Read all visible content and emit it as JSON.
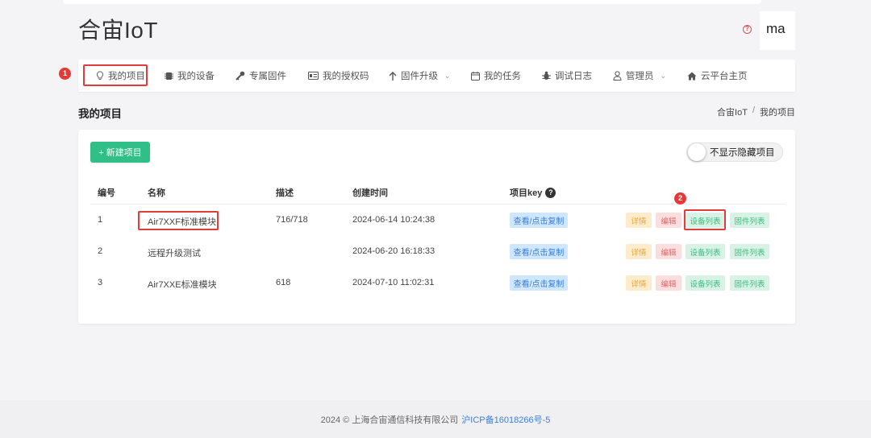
{
  "app": {
    "brand": "合宙IoT",
    "user": "ma"
  },
  "nav": [
    {
      "key": "projects",
      "label": "我的项目",
      "icon": "lightbulb-icon",
      "caret": false
    },
    {
      "key": "devices",
      "label": "我的设备",
      "icon": "chip-icon",
      "caret": false
    },
    {
      "key": "firmware",
      "label": "专属固件",
      "icon": "key-icon",
      "caret": false
    },
    {
      "key": "license",
      "label": "我的授权码",
      "icon": "id-card-icon",
      "caret": false
    },
    {
      "key": "upgrade",
      "label": "固件升级",
      "icon": "arrow-up-icon",
      "caret": true
    },
    {
      "key": "tasks",
      "label": "我的任务",
      "icon": "calendar-icon",
      "caret": false
    },
    {
      "key": "debug",
      "label": "调试日志",
      "icon": "bug-icon",
      "caret": false
    },
    {
      "key": "admin",
      "label": "管理员",
      "icon": "user-icon",
      "caret": true
    },
    {
      "key": "home",
      "label": "云平台主页",
      "icon": "home-icon",
      "caret": false
    }
  ],
  "page": {
    "title": "我的项目",
    "breadcrumb": [
      "合宙IoT",
      "我的项目"
    ],
    "new_button": "+ 新建项目",
    "hide_toggle_label": "不显示隐藏项目",
    "hide_toggle_on": false
  },
  "table": {
    "headers": {
      "id": "编号",
      "name": "名称",
      "desc": "描述",
      "created": "创建时间",
      "key": "项目key"
    },
    "rows": [
      {
        "id": "1",
        "name": "Air7XXF标准模块",
        "desc": "716/718",
        "created": "2024-06-14 10:24:38"
      },
      {
        "id": "2",
        "name": "远程升级测试",
        "desc": "",
        "created": "2024-06-20 16:18:33"
      },
      {
        "id": "3",
        "name": "Air7XXE标准模块",
        "desc": "618",
        "created": "2024-07-10 11:02:31"
      }
    ],
    "key_button": "查看/点击复制",
    "actions": {
      "detail": "详情",
      "edit": "编辑",
      "devices": "设备列表",
      "firmware": "固件列表"
    }
  },
  "annotations": {
    "badge1": "1",
    "badge2": "2"
  },
  "footer": {
    "copyright": "2024 © 上海合宙通信科技有限公司",
    "icp": "沪ICP备16018266号-5"
  },
  "colors": {
    "accent_green": "#2fbf87",
    "highlight_red": "#e23b3b",
    "link_blue": "#3b7fd6"
  }
}
